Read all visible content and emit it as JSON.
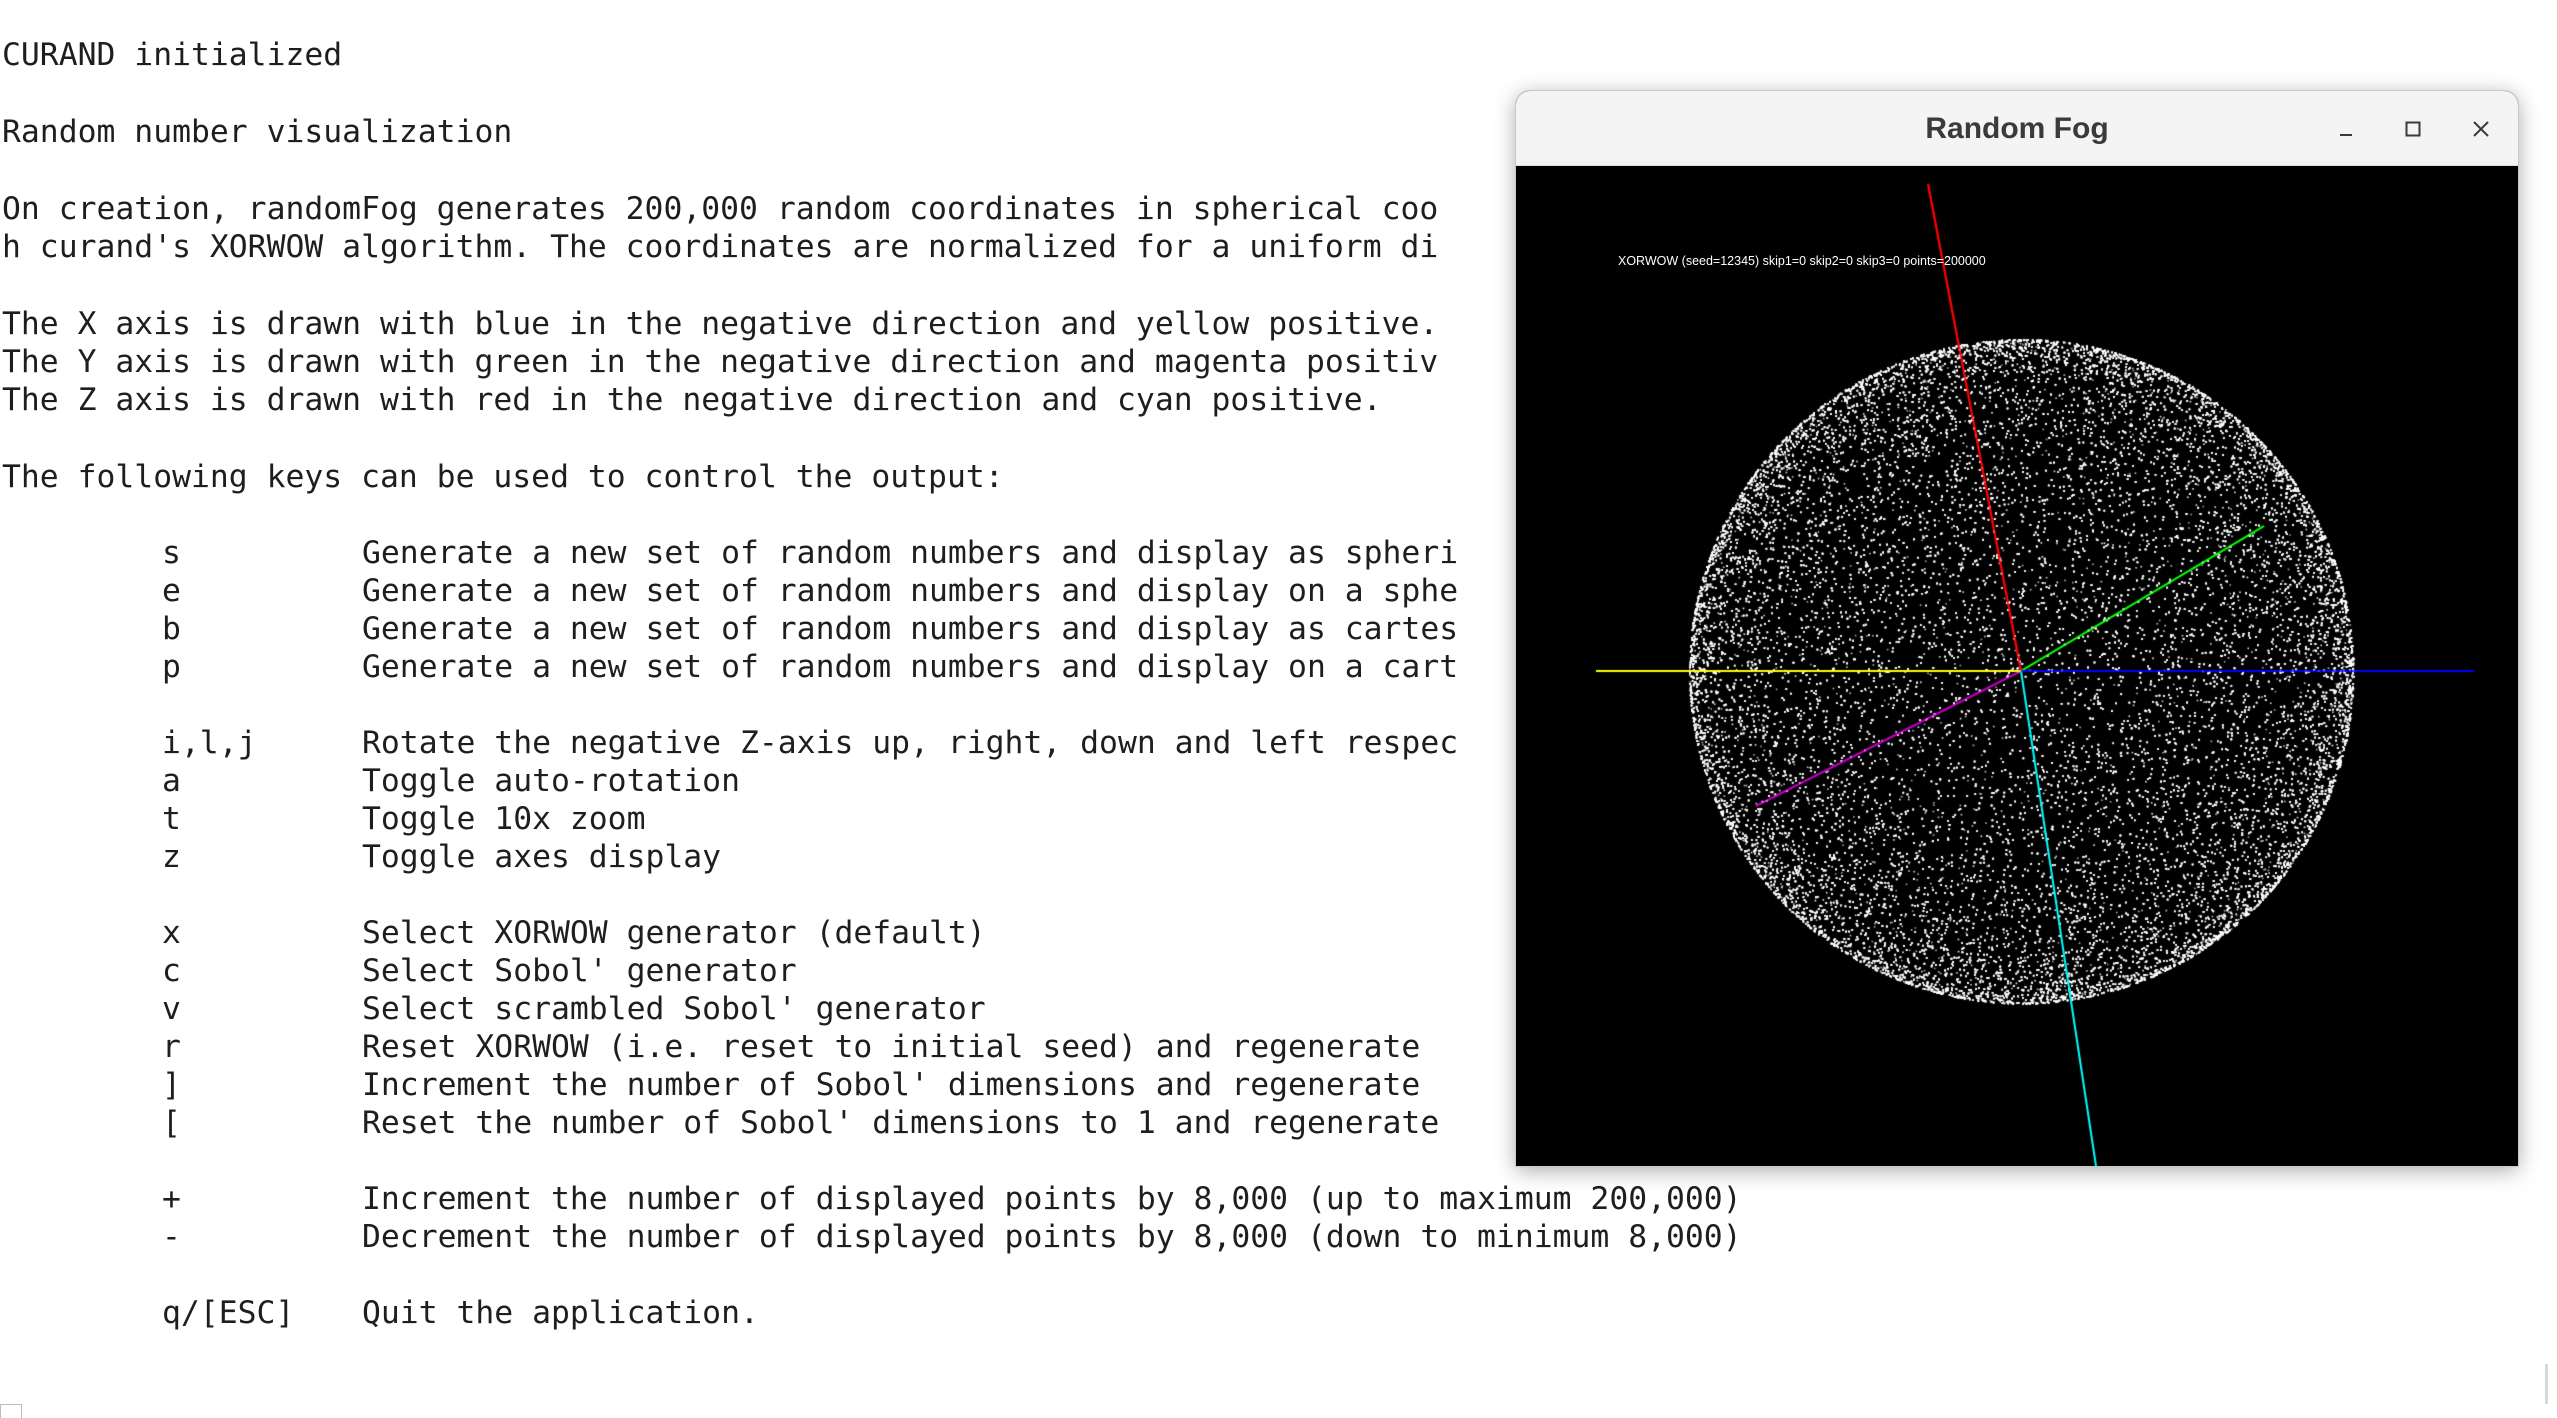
{
  "terminal": {
    "lines": [
      "CURAND initialized",
      "Random number visualization",
      "On creation, randomFog generates 200,000 random coordinates in spherical coo",
      "h curand's XORWOW algorithm. The coordinates are normalized for a uniform di",
      "The X axis is drawn with blue in the negative direction and yellow positive.",
      "The Y axis is drawn with green in the negative direction and magenta positiv",
      "The Z axis is drawn with red in the negative direction and cyan positive.",
      "The following keys can be used to control the output:"
    ],
    "keys": [
      {
        "key": "s",
        "desc": "Generate a new set of random numbers and display as spheri"
      },
      {
        "key": "e",
        "desc": "Generate a new set of random numbers and display on a sphe"
      },
      {
        "key": "b",
        "desc": "Generate a new set of random numbers and display as cartes"
      },
      {
        "key": "p",
        "desc": "Generate a new set of random numbers and display on a cart"
      },
      {
        "key": "i,l,j",
        "desc": "Rotate the negative Z-axis up, right, down and left respec"
      },
      {
        "key": "a",
        "desc": "Toggle auto-rotation"
      },
      {
        "key": "t",
        "desc": "Toggle 10x zoom"
      },
      {
        "key": "z",
        "desc": "Toggle axes display"
      },
      {
        "key": "x",
        "desc": "Select XORWOW generator (default)"
      },
      {
        "key": "c",
        "desc": "Select Sobol' generator"
      },
      {
        "key": "v",
        "desc": "Select scrambled Sobol' generator"
      },
      {
        "key": "r",
        "desc": "Reset XORWOW (i.e. reset to initial seed) and regenerate"
      },
      {
        "key": "]",
        "desc": "Increment the number of Sobol' dimensions and regenerate"
      },
      {
        "key": "[",
        "desc": "Reset the number of Sobol' dimensions to 1 and regenerate"
      },
      {
        "key": "+",
        "desc": "Increment the number of displayed points by 8,000 (up to maximum 200,000)"
      },
      {
        "key": "-",
        "desc": "Decrement the number of displayed points by 8,000 (down to minimum 8,000)"
      },
      {
        "key": "q/[ESC]",
        "desc": "Quit the application."
      }
    ]
  },
  "window": {
    "title": "Random Fog",
    "info": "XORWOW (seed=12345) skip1=0 skip2=0 skip3=0 points=200000",
    "controls": {
      "minimize": "minimize-icon",
      "maximize": "maximize-icon",
      "close": "close-icon"
    }
  },
  "colors": {
    "x_negative": "#0000ff",
    "x_positive": "#ffff00",
    "y_negative": "#00ff00",
    "y_positive": "#ff00ff",
    "z_negative": "#ff0000",
    "z_positive": "#00ffff",
    "points": "#ffffff",
    "background": "#000000"
  }
}
